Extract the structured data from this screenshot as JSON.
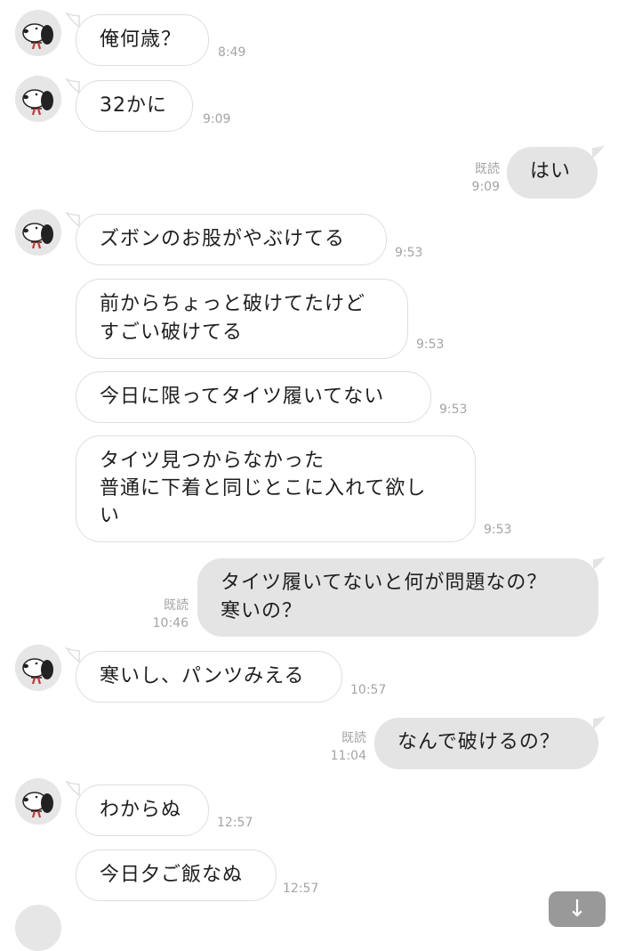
{
  "messages": [
    {
      "side": "in",
      "avatar": true,
      "text": "俺何歳？",
      "time": "8:49"
    },
    {
      "side": "in",
      "avatar": true,
      "text": "32かに",
      "time": "9:09"
    },
    {
      "side": "out",
      "read": "既読",
      "text": "はい",
      "time": "9:09"
    },
    {
      "side": "in",
      "avatar": true,
      "text": "ズボンのお股がやぶけてる",
      "time": "9:53"
    },
    {
      "side": "in",
      "avatar": false,
      "text": "前からちょっと破けてたけど\nすごい破けてる",
      "time": "9:53"
    },
    {
      "side": "in",
      "avatar": false,
      "text": "今日に限ってタイツ履いてない",
      "time": "9:53"
    },
    {
      "side": "in",
      "avatar": false,
      "text": "タイツ見つからなかった\n普通に下着と同じとこに入れて欲し\nい",
      "time": "9:53"
    },
    {
      "side": "out",
      "read": "既読",
      "text": "タイツ履いてないと何が問題なの？\n寒いの？",
      "time": "10:46"
    },
    {
      "side": "in",
      "avatar": true,
      "text": "寒いし、パンツみえる",
      "time": "10:57"
    },
    {
      "side": "out",
      "read": "既読",
      "text": "なんで破けるの？",
      "time": "11:04"
    },
    {
      "side": "in",
      "avatar": true,
      "text": "わからぬ",
      "time": "12:57"
    },
    {
      "side": "in",
      "avatar": false,
      "text": "今日夕ご飯なぬ",
      "time": "12:57"
    }
  ],
  "scroll_button": {
    "label": "↓"
  },
  "colors": {
    "incoming_bubble": "#ffffff",
    "incoming_border": "#dedede",
    "outgoing_bubble": "#e4e4e4",
    "timestamp": "#a4a4a4",
    "avatar_bg": "#e6e6e6"
  }
}
